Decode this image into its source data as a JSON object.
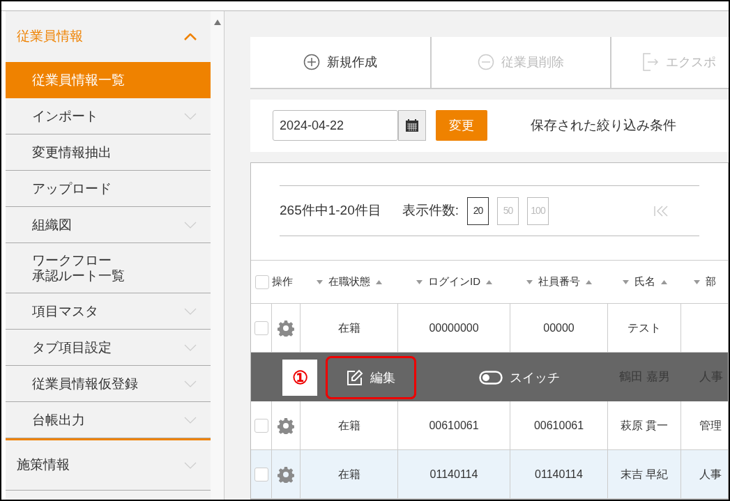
{
  "sidebar": {
    "section": {
      "label": "従業員情報",
      "expanded": true
    },
    "items": [
      {
        "label": "従業員情報一覧",
        "selected": true,
        "expandable": false
      },
      {
        "label": "インポート",
        "selected": false,
        "expandable": true
      },
      {
        "label": "変更情報抽出",
        "selected": false,
        "expandable": false
      },
      {
        "label": "アップロード",
        "selected": false,
        "expandable": false
      },
      {
        "label": "組織図",
        "selected": false,
        "expandable": true
      },
      {
        "lines": [
          "ワークフロー",
          "承認ルート一覧"
        ],
        "selected": false,
        "expandable": false
      },
      {
        "label": "項目マスタ",
        "selected": false,
        "expandable": true
      },
      {
        "label": "タブ項目設定",
        "selected": false,
        "expandable": true
      },
      {
        "label": "従業員情報仮登録",
        "selected": false,
        "expandable": true
      },
      {
        "label": "台帳出力",
        "selected": false,
        "expandable": true
      }
    ],
    "other_sections": [
      {
        "label": "施策情報",
        "expanded": false
      }
    ]
  },
  "toolbar": [
    {
      "label": "新規作成",
      "kind": "add",
      "disabled": false
    },
    {
      "label": "従業員削除",
      "kind": "remove",
      "disabled": true
    },
    {
      "label": "エクスポ",
      "kind": "export",
      "disabled": true
    }
  ],
  "filter": {
    "date": "2024-04-22",
    "apply_button": "変更",
    "saved_filters": "保存された絞り込み条件"
  },
  "pagination": {
    "summary": "265件中1-20件目",
    "page_size_label": "表示件数:",
    "page_sizes": [
      {
        "label": "20",
        "selected": true
      },
      {
        "label": "50",
        "selected": false
      },
      {
        "label": "100",
        "selected": false
      }
    ]
  },
  "table": {
    "columns": [
      "操作",
      "在職状態",
      "ログインID",
      "社員番号",
      "氏名",
      "部"
    ],
    "select_all_checked": false,
    "rows": [
      {
        "status": "在籍",
        "login_id": "00000000",
        "employee_no": "00000",
        "name": "テスト",
        "highlighted": false,
        "overlaid": false
      },
      {
        "name": "鶴田 嘉男",
        "department": "人事",
        "overlaid": true
      },
      {
        "status": "在籍",
        "login_id": "00610061",
        "employee_no": "00610061",
        "name": "萩原 貫一",
        "department": "管理",
        "highlighted": false,
        "overlaid": false
      },
      {
        "status": "在籍",
        "login_id": "01140114",
        "employee_no": "01140114",
        "name": "末吉 早紀",
        "department": "人事",
        "highlighted": true,
        "overlaid": false
      }
    ]
  },
  "row_actions": {
    "marker": "①",
    "actions": [
      {
        "label": "編集",
        "kind": "edit",
        "emphasized": true
      },
      {
        "label": "スイッチ",
        "kind": "switch",
        "emphasized": false
      }
    ]
  }
}
